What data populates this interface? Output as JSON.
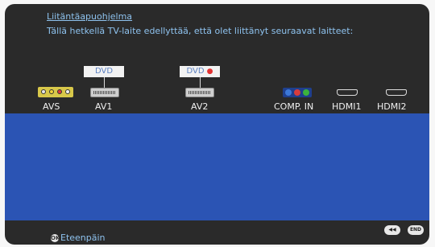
{
  "header": {
    "title": "Liitäntäapuohjelma",
    "subtitle": "Tällä hetkellä TV-laite edellyttää, että olet liittänyt seuraavat laitteet:"
  },
  "ports": {
    "avs": "AVS",
    "av1": "AV1",
    "av2": "AV2",
    "comp_in": "COMP. IN",
    "hdmi1": "HDMI1",
    "hdmi2": "HDMI2"
  },
  "devices": {
    "av1_device": "DVD",
    "av2_device": "DVD",
    "av2_indicator": "●"
  },
  "footer": {
    "next_icon": "OK",
    "next_label": "Eteenpäin",
    "back_key": "◀◀",
    "end_key": "END"
  },
  "colors": {
    "screen_bg": "#2a2a2a",
    "panel_blue": "#2b54b4",
    "link_text": "#8ec2ee",
    "warning_dot": "#e23232"
  }
}
